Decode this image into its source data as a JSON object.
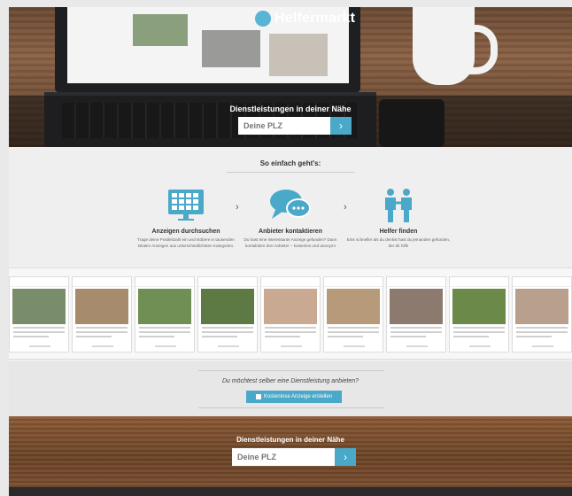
{
  "brand": {
    "name": "Helfermarkt",
    "accent": "#4aa8c9"
  },
  "hero": {
    "search_title": "Dienstleistungen in deiner Nähe",
    "search_placeholder": "Deine PLZ",
    "search_button_icon": "chevron-right-icon"
  },
  "how": {
    "title": "So einfach geht's:",
    "steps": [
      {
        "icon": "monitor-grid-icon",
        "title": "Anzeigen durchsuchen",
        "desc": "Trage deine Postleitzahl ein und stöbere in tausenden lokalen Anzeigen aus unterschiedlichsten Kategorien."
      },
      {
        "icon": "chat-bubbles-icon",
        "title": "Anbieter kontaktieren",
        "desc": "Du hast eine interessante Anzeige gefunden? Dann kontaktiere den Anbieter – kostenlos und anonym!"
      },
      {
        "icon": "two-people-icon",
        "title": "Helfer finden",
        "desc": "Eins schneller als du denkst hast du jemanden gefunden, der dir hilft!"
      }
    ],
    "arrow_glyph": "›"
  },
  "offer": {
    "question": "Du möchtest selber eine Dienstleistung anbieten?",
    "button_label": "Kostenlose Anzeige erstellen"
  },
  "bottom": {
    "search_title": "Dienstleistungen in deiner Nähe",
    "search_placeholder": "Deine PLZ"
  },
  "cards": [
    {
      "color": "#7a8d6a"
    },
    {
      "color": "#a68b6d"
    },
    {
      "color": "#6f8f55"
    },
    {
      "color": "#5d7a44"
    },
    {
      "color": "#c9a991"
    },
    {
      "color": "#b79a7a"
    },
    {
      "color": "#8c7a6e"
    },
    {
      "color": "#6b8a4a"
    },
    {
      "color": "#b9a08c"
    },
    {
      "color": "#7d8f74"
    }
  ]
}
